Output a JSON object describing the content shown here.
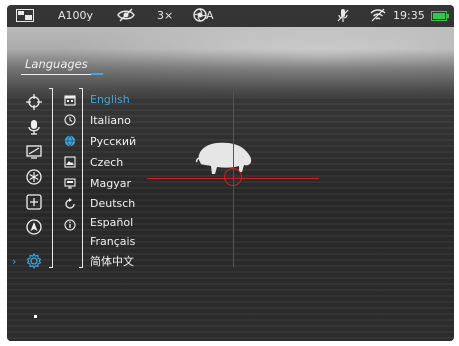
{
  "status_bar": {
    "model": "A100y",
    "zoom": "3×",
    "mode": "A",
    "time": "19:35",
    "battery_color": "#2ec84a",
    "icons": [
      "display-mode-icon",
      "eye-off-icon",
      "aperture-icon",
      "mic-off-icon",
      "wifi-off-icon",
      "battery-icon"
    ]
  },
  "menu": {
    "title": "Languages",
    "accent_color": "#3fa8e0",
    "left_icons": [
      "crosshair-icon",
      "microphone-icon",
      "display-icon",
      "settings-asterisk-icon",
      "plus-square-icon",
      "navigation-icon",
      "gear-icon"
    ],
    "mid_icons": [
      "calendar-icon",
      "clock-icon",
      "globe-icon",
      "image-icon",
      "screen-icon",
      "reset-icon",
      "info-icon"
    ],
    "languages": [
      "English",
      "Italiano",
      "Русский",
      "Czech",
      "Magyar",
      "Deutsch",
      "Español",
      "Français",
      "简体中文"
    ],
    "selected_language": "English"
  },
  "reticle": {
    "color": "#d21f26"
  }
}
